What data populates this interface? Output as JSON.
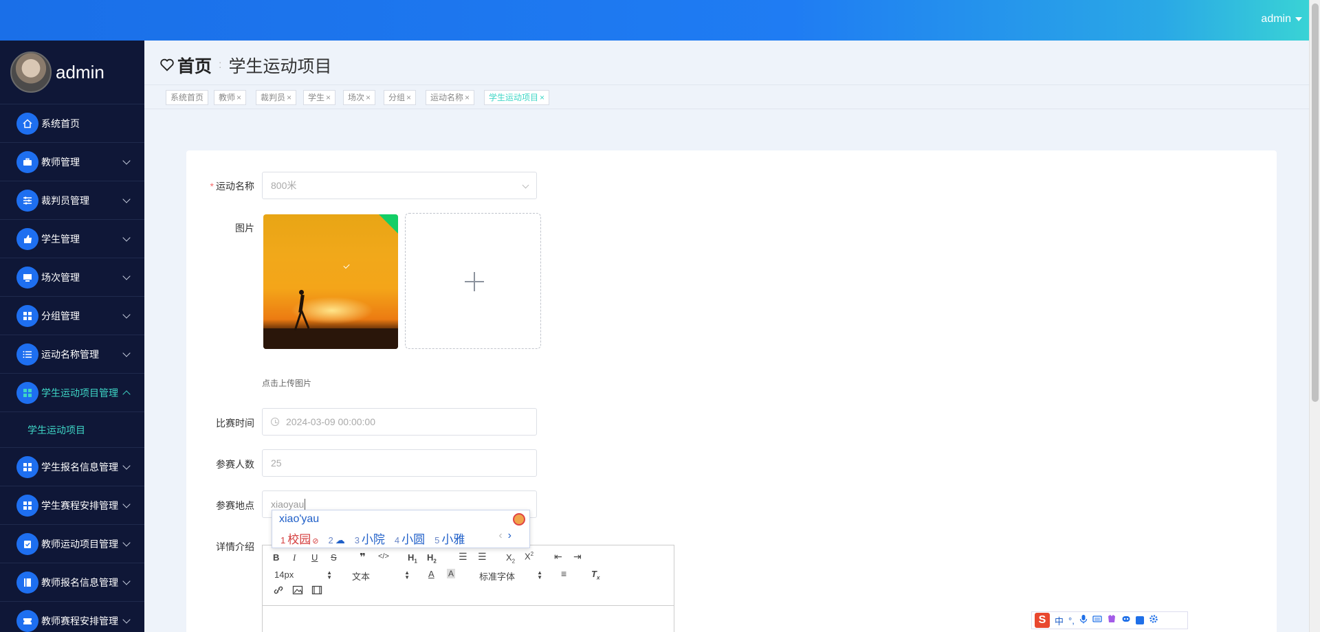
{
  "topbar": {
    "user": "admin"
  },
  "sidebar": {
    "profile_name": "admin",
    "items": [
      {
        "label": "系统首页",
        "icon": "home-icon"
      },
      {
        "label": "教师管理",
        "icon": "briefcase-icon"
      },
      {
        "label": "裁判员管理",
        "icon": "sliders-icon"
      },
      {
        "label": "学生管理",
        "icon": "thumbs-up-icon"
      },
      {
        "label": "场次管理",
        "icon": "monitor-icon"
      },
      {
        "label": "分组管理",
        "icon": "grid-icon"
      },
      {
        "label": "运动名称管理",
        "icon": "list-icon"
      },
      {
        "label": "学生运动项目管理",
        "icon": "grid-icon"
      },
      {
        "label": "学生报名信息管理",
        "icon": "grid-icon"
      },
      {
        "label": "学生赛程安排管理",
        "icon": "grid-icon"
      },
      {
        "label": "教师运动项目管理",
        "icon": "clipboard-icon"
      },
      {
        "label": "教师报名信息管理",
        "icon": "book-icon"
      },
      {
        "label": "教师赛程安排管理",
        "icon": "ticket-icon"
      }
    ],
    "submenu": {
      "label": "学生运动项目"
    }
  },
  "breadcrumb": {
    "home": "首页",
    "current": "学生运动项目"
  },
  "tags": [
    "系统首页",
    "教师",
    "裁判员",
    "学生",
    "场次",
    "分组",
    "运动名称",
    "学生运动项目"
  ],
  "form": {
    "name_label": "运动名称",
    "name_value": "800米",
    "image_label": "图片",
    "upload_hint": "点击上传图片",
    "time_label": "比赛时间",
    "time_value": "2024-03-09 00:00:00",
    "count_label": "参赛人数",
    "count_value": "25",
    "place_label": "参赛地点",
    "place_value": "xiaoyau",
    "detail_label": "详情介绍"
  },
  "ime": {
    "pinyin": "xiao'yau",
    "candidates": [
      {
        "n": "1",
        "text": "校园"
      },
      {
        "n": "2",
        "text": ""
      },
      {
        "n": "3",
        "text": "小院"
      },
      {
        "n": "4",
        "text": "小圆"
      },
      {
        "n": "5",
        "text": "小雅"
      }
    ],
    "prev": "‹",
    "next": "›"
  },
  "editor": {
    "font_size": "14px",
    "text_type": "文本",
    "font_family": "标准字体"
  },
  "ime_bar": {
    "mode": "中",
    "punct": "°,"
  }
}
